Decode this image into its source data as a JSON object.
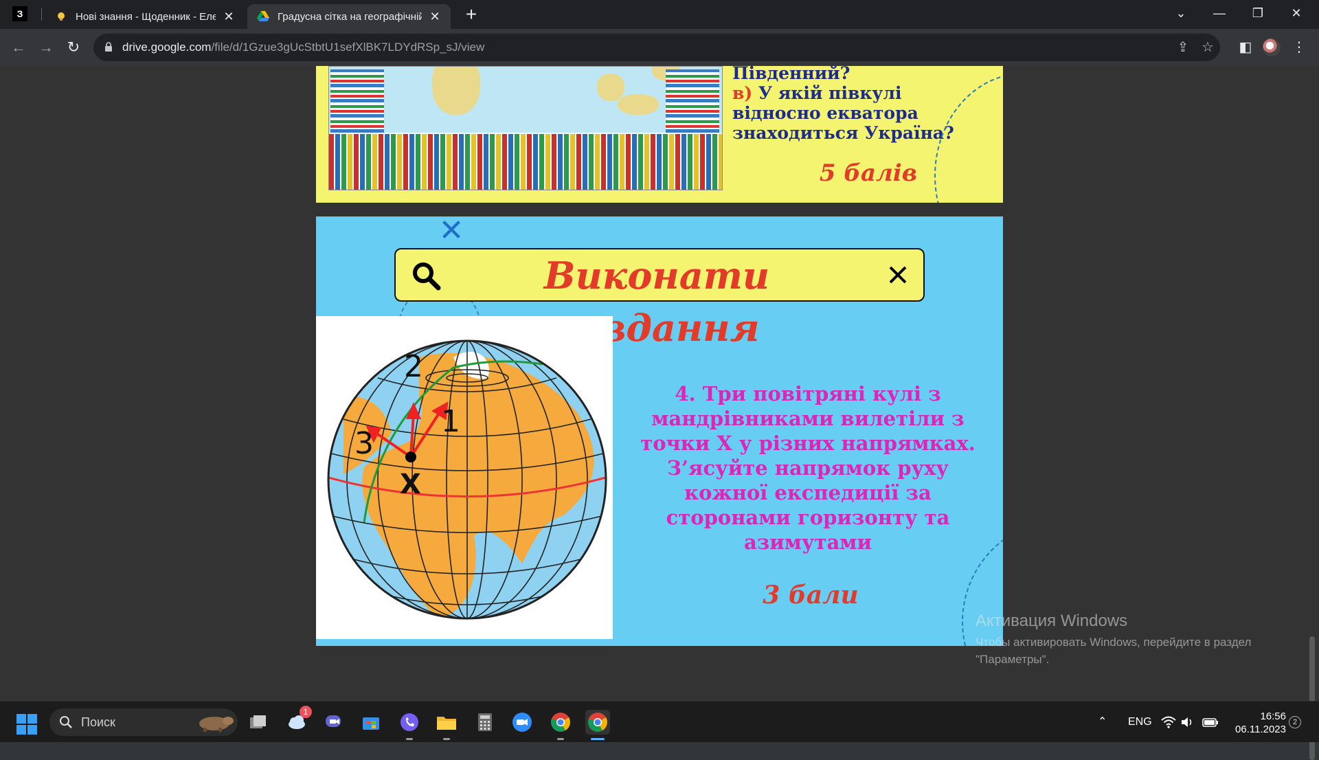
{
  "browser": {
    "pinned_tab_label": "З",
    "tabs": [
      {
        "title": "Нові знання - Щоденник - Електронний"
      },
      {
        "title": "Градусна сітка на географічній карті"
      }
    ],
    "new_tab_label": "+",
    "url_host": "drive.google.com",
    "url_path": "/file/d/1Gzue3gUcStbtU1sefXlBK7LDYdRSp_sJ/view"
  },
  "slide1": {
    "line1": "Південний?",
    "label_v": "в)",
    "question_v": "У якій півкулі відносно екватора знаходиться Україна?",
    "points": "5 балів"
  },
  "slide2": {
    "heading": "Виконати завдання",
    "task": "4. Три повітряні кулі з мандрівниками вилетіли з точки Х у різних напрямках. З’ясуйте напрямок руху кожної експедиції за сторонами горизонту та азимутами",
    "points": "3 бали",
    "globe": {
      "label_1": "1",
      "label_2": "2",
      "label_3": "3",
      "label_x": "Х"
    }
  },
  "watermark": {
    "title": "Активация Windows",
    "text_line1": "Чтобы активировать Windows, перейдите в раздел",
    "text_line2": "\"Параметры\"."
  },
  "taskbar": {
    "search_placeholder": "Поиск",
    "weather_badge": "1",
    "language": "ENG",
    "time": "16:56",
    "date": "06.11.2023",
    "notification_count": "2"
  },
  "colors": {
    "slide1_bg": "#f5f471",
    "slide2_bg": "#67cdf3",
    "heading_red": "#e23b2a",
    "task_magenta": "#e023b9",
    "question_blue": "#1d2c8c"
  }
}
